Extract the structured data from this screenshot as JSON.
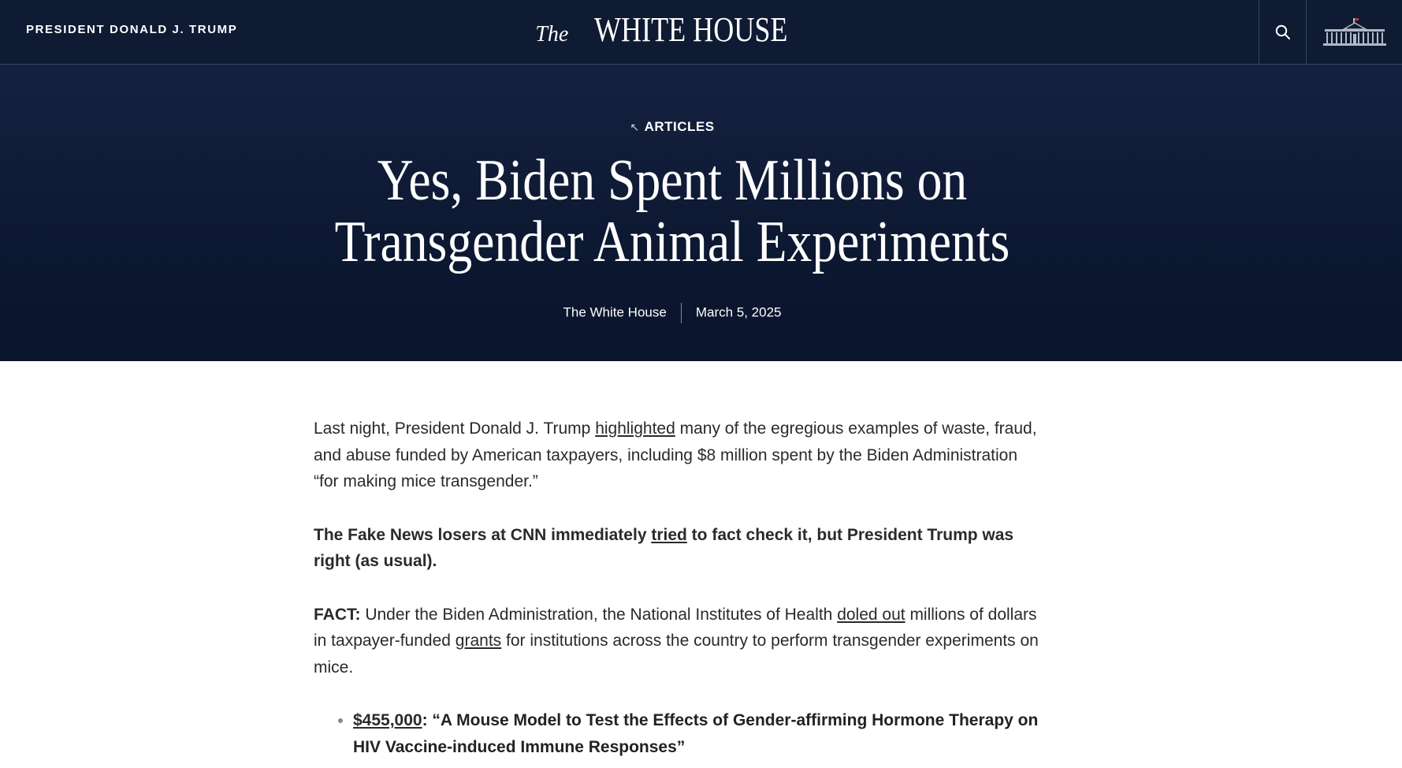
{
  "header": {
    "left_label": "PRESIDENT DONALD J. TRUMP",
    "logo_the": "The",
    "logo_main": "WHITE HOUSE",
    "search_icon": "search-icon",
    "emblem_icon": "white-house-building-icon"
  },
  "hero": {
    "kicker_icon": "arrow-up-left-icon",
    "kicker": "ARTICLES",
    "title_line1": "Yes, Biden Spent Millions on",
    "title_line2": "Transgender Animal Experiments",
    "author": "The White House",
    "date": "March 5, 2025"
  },
  "article": {
    "p1": {
      "before": "Last night, President Donald J. Trump ",
      "link": "highlighted",
      "after": " many of the egregious examples of waste, fraud, and abuse funded by American taxpayers, including $8 million spent by the Biden Administration “for making mice transgender.”"
    },
    "p2": {
      "before": "The Fake News losers at CNN immediately ",
      "link": "tried",
      "after": " to fact check it, but President Trump was right (as usual)."
    },
    "p3": {
      "label": "FACT:",
      "before": " Under the Biden Administration, the National Institutes of Health ",
      "link1": "doled out",
      "middle": " millions of dollars in taxpayer-funded ",
      "link2": "grants",
      "after": " for institutions across the country to perform transgender experiments on mice."
    },
    "bullets": [
      {
        "amount": "$455,000",
        "text": ": “A Mouse Model to Test the Effects of Gender-affirming Hormone Therapy on HIV Vaccine-induced Immune Responses”"
      }
    ]
  },
  "colors": {
    "header_bg": "#0f1a33",
    "hero_bg": "#0d1832",
    "text": "#2a2a2a"
  }
}
